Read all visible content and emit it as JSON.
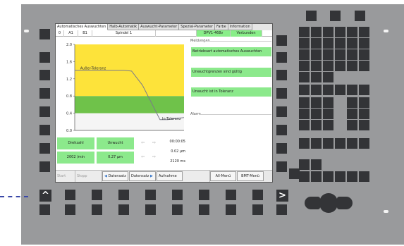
{
  "tabs": [
    {
      "label": "Automatisches Auswuchten",
      "active": true
    },
    {
      "label": "Halb-Automatik",
      "active": false
    },
    {
      "label": "Auswucht-Parameter",
      "active": false
    },
    {
      "label": "Spezial-Parameter",
      "active": false
    },
    {
      "label": "Farbe",
      "active": false
    },
    {
      "label": "Information",
      "active": false
    }
  ],
  "status": {
    "num": "0",
    "ch1": "A1",
    "ch2": "B1",
    "spindle": "Spindel 1",
    "empty": "",
    "device": "DPV1-468v",
    "connection": "Verbunden"
  },
  "chart_data": {
    "type": "line",
    "title": "",
    "xlabel": "",
    "ylabel": "",
    "ylim": [
      0,
      2.0
    ],
    "yticks": [
      "2.0",
      "1.6",
      "1.2",
      "0.8",
      "0.4",
      "0.0"
    ],
    "grid": false,
    "zones": [
      {
        "from": 0.0,
        "to": 0.4,
        "color": "#f5f5f5"
      },
      {
        "from": 0.4,
        "to": 0.8,
        "color": "#6fc24a"
      },
      {
        "from": 0.8,
        "to": 2.0,
        "color": "#fde33a"
      }
    ],
    "annotations": [
      {
        "text": "Außer-Toleranz",
        "x": 0.05,
        "y": 1.42
      },
      {
        "text": "In-Toleranz",
        "x": 0.8,
        "y": 0.25
      }
    ],
    "series": [
      {
        "x": [
          0,
          0.45,
          0.52,
          0.62,
          0.72,
          0.78,
          0.85,
          1.0
        ],
        "values": [
          1.4,
          1.4,
          1.38,
          1.05,
          0.55,
          0.25,
          0.25,
          0.3
        ],
        "color": "#7a7a8a"
      }
    ]
  },
  "messages": {
    "header": "Meldungen",
    "items": [
      "Betriebsart automatisches Auswuchten",
      "Unwuchtgrenzen sind gültig",
      "Unwucht ist in Toleranz"
    ]
  },
  "alarm": {
    "header": "Alarm"
  },
  "readouts": {
    "speed_label": "Drehzahl",
    "speed_value": "2002 /min",
    "imbalance_label": "Unwucht",
    "imbalance_value": "0.27 µm",
    "arrow_left": "⇦",
    "arrow_right": "⇨",
    "time": "00:00:05",
    "displacement": "0.02 µm",
    "duration": "2120 ms"
  },
  "bottombar": {
    "start": "Start",
    "stop": "Stopp",
    "dataset_prev": "Datensatz",
    "dataset_next": "Datensatz",
    "record": "Aufnahme",
    "all_menu": "All-Menü",
    "bmt_menu": "BMT-Menü",
    "icon_prev": "◀",
    "icon_next": "▶"
  },
  "hardware": {
    "left_arrow": "^",
    "right_arrow": ">"
  }
}
